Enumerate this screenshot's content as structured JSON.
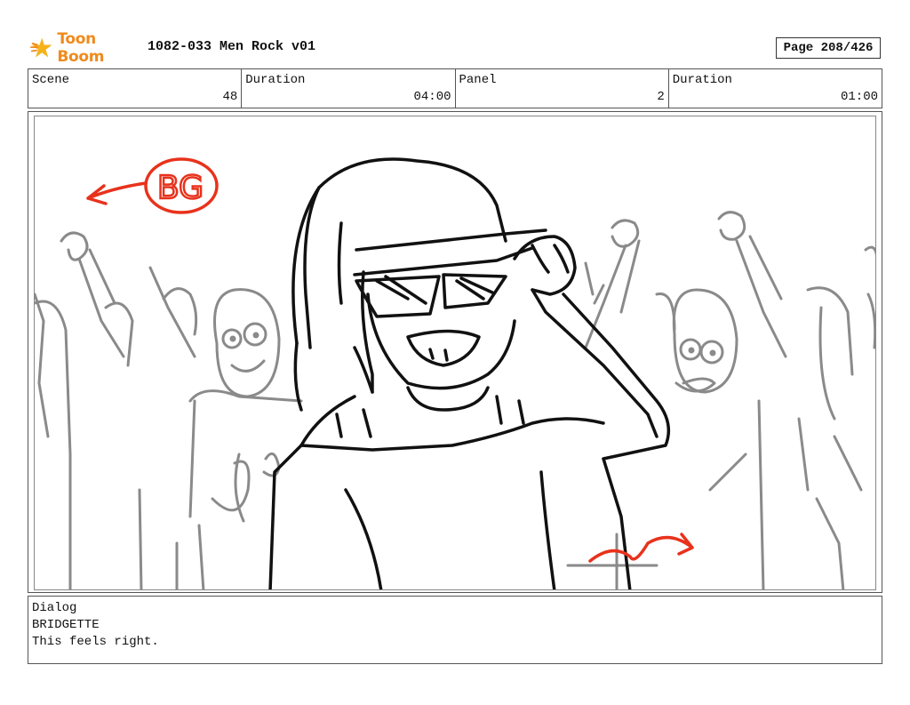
{
  "header": {
    "logo_text": "Toon Boom",
    "logo_colors": {
      "star": "#f5b21c",
      "text": "#f08a1c"
    },
    "doc_title": "1082-033 Men Rock v01",
    "page_label": "Page 208/426"
  },
  "info": {
    "scene_label": "Scene",
    "scene_value": "48",
    "duration1_label": "Duration",
    "duration1_value": "04:00",
    "panel_label": "Panel",
    "panel_value": "2",
    "duration2_label": "Duration",
    "duration2_value": "01:00"
  },
  "panel": {
    "annotation_text": "BG",
    "annotation_color": "#e8321c",
    "sketch_line_color": "#111111",
    "crowd_line_color": "#8a8a8a"
  },
  "dialog": {
    "label": "Dialog",
    "speaker": "BRIDGETTE",
    "line": "This feels right."
  }
}
